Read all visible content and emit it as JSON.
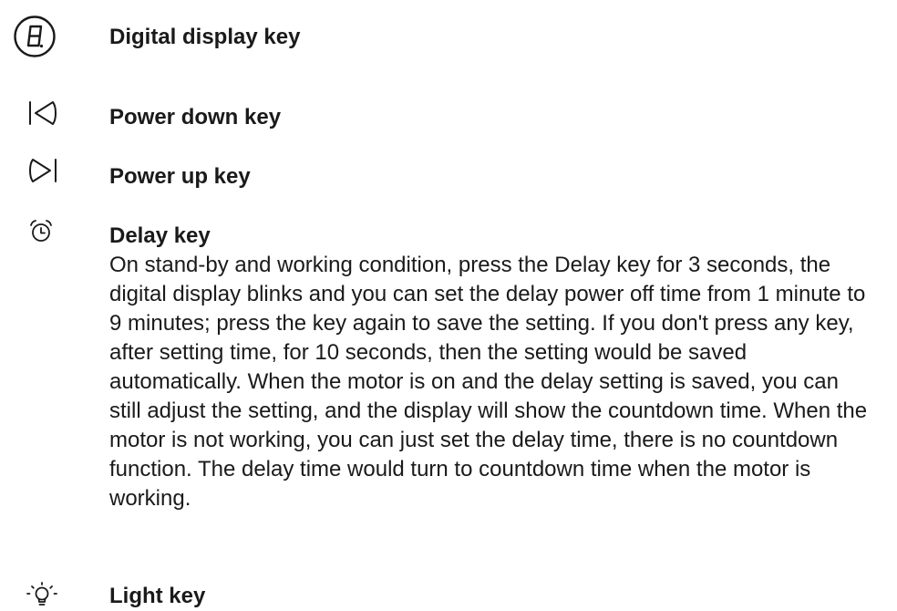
{
  "manual": {
    "items": [
      {
        "icon": "digital-display-icon",
        "title": "Digital display key"
      },
      {
        "icon": "power-down-icon",
        "title": "Power down key"
      },
      {
        "icon": "power-up-icon",
        "title": "Power up key"
      },
      {
        "icon": "alarm-clock-icon",
        "title": "Delay key",
        "description": "On stand-by and working condition, press the Delay key for 3 seconds, the digital display blinks and you can set the delay power off time from 1 minute to 9 minutes; press the key again to save the setting. If you don't press any key, after setting time, for 10 seconds, then the setting would be saved automatically. When the motor is on and the delay setting is saved, you can still adjust the setting, and the display will show the countdown time. When the motor is not working, you can just set the delay time, there is no countdown function. The delay time would turn to countdown time when the motor is working."
      },
      {
        "icon": "light-bulb-icon",
        "title": "Light key"
      }
    ]
  }
}
